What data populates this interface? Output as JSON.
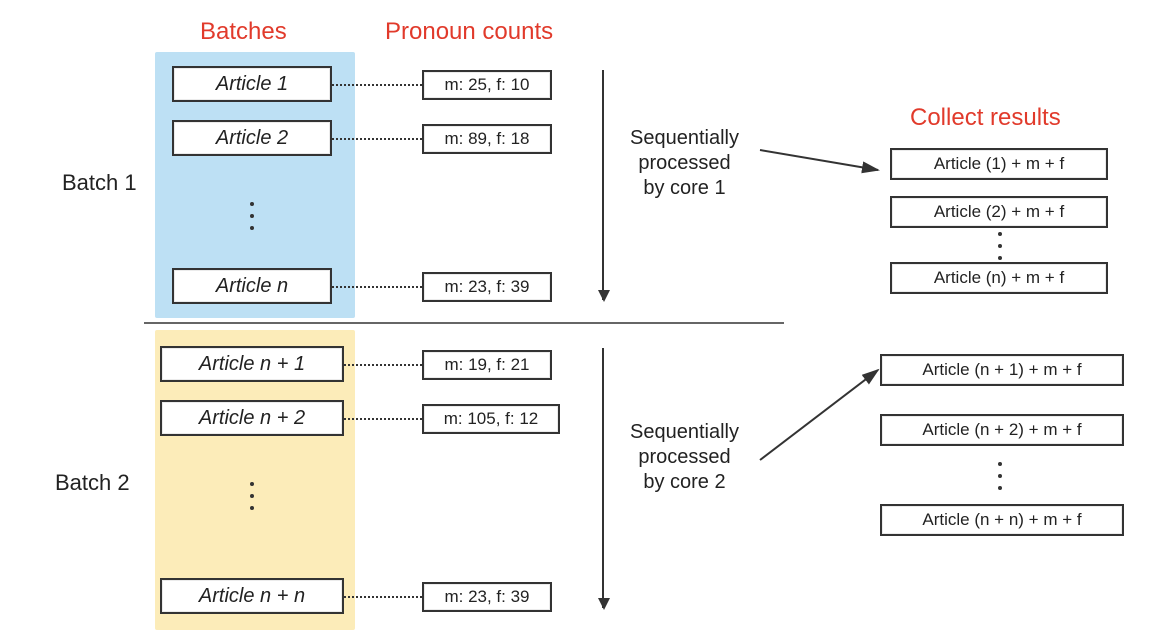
{
  "headings": {
    "batches": "Batches",
    "pronoun_counts": "Pronoun counts",
    "collect_results": "Collect results"
  },
  "batch_labels": {
    "b1": "Batch 1",
    "b2": "Batch 2"
  },
  "batch1": {
    "articles": {
      "a1": "Article 1",
      "a2": "Article 2",
      "an": "Article n"
    },
    "counts": {
      "c1": "m: 25, f: 10",
      "c2": "m: 89, f: 18",
      "cn": "m: 23, f: 39"
    },
    "annot": {
      "line1": "Sequentially",
      "line2": "processed",
      "line3": "by core 1"
    }
  },
  "batch2": {
    "articles": {
      "a1": "Article n + 1",
      "a2": "Article n + 2",
      "an": "Article n + n"
    },
    "counts": {
      "c1": "m: 19, f: 21",
      "c2": "m: 105, f: 12",
      "cn": "m: 23, f: 39"
    },
    "annot": {
      "line1": "Sequentially",
      "line2": "processed",
      "line3": "by core 2"
    }
  },
  "results": {
    "r1": "Article (1) + m + f",
    "r2": "Article (2) + m + f",
    "rn": "Article (n) + m + f",
    "s1": "Article (n + 1) + m + f",
    "s2": "Article (n + 2) + m + f",
    "sn": "Article (n + n) + m + f"
  },
  "colors": {
    "batch1_bg": "#bde0f4",
    "batch2_bg": "#fcecb9",
    "accent": "#e13a2b"
  }
}
